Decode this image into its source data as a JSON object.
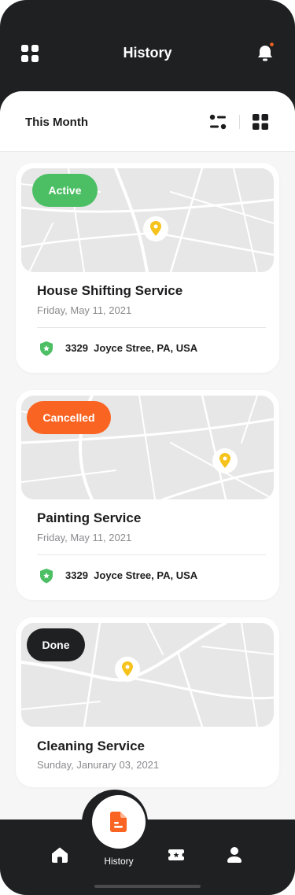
{
  "header": {
    "title": "History"
  },
  "subheader": {
    "period": "This Month"
  },
  "cards": [
    {
      "status": "Active",
      "status_color": "#4cbf64",
      "title": "House Shifting Service",
      "date": "Friday, May 11, 2021",
      "address_num": "3329",
      "address": "Joyce Stree, PA, USA"
    },
    {
      "status": "Cancelled",
      "status_color": "#fa6422",
      "title": "Painting Service",
      "date": "Friday, May 11, 2021",
      "address_num": "3329",
      "address": "Joyce Stree, PA, USA"
    },
    {
      "status": "Done",
      "status_color": "#1f2022",
      "title": "Cleaning Service",
      "date": "Sunday, Janurary 03, 2021"
    }
  ],
  "bottom_nav": {
    "active_label": "History",
    "accent": "#fa6422",
    "pin_color": "#f6c21c",
    "shield_color": "#4cbf64"
  },
  "icons": [
    "menu-grid-icon",
    "bell-icon",
    "filter-icon",
    "grid-view-icon",
    "location-pin-icon",
    "shield-star-icon",
    "history-doc-icon",
    "home-icon",
    "ticket-icon",
    "user-icon"
  ]
}
